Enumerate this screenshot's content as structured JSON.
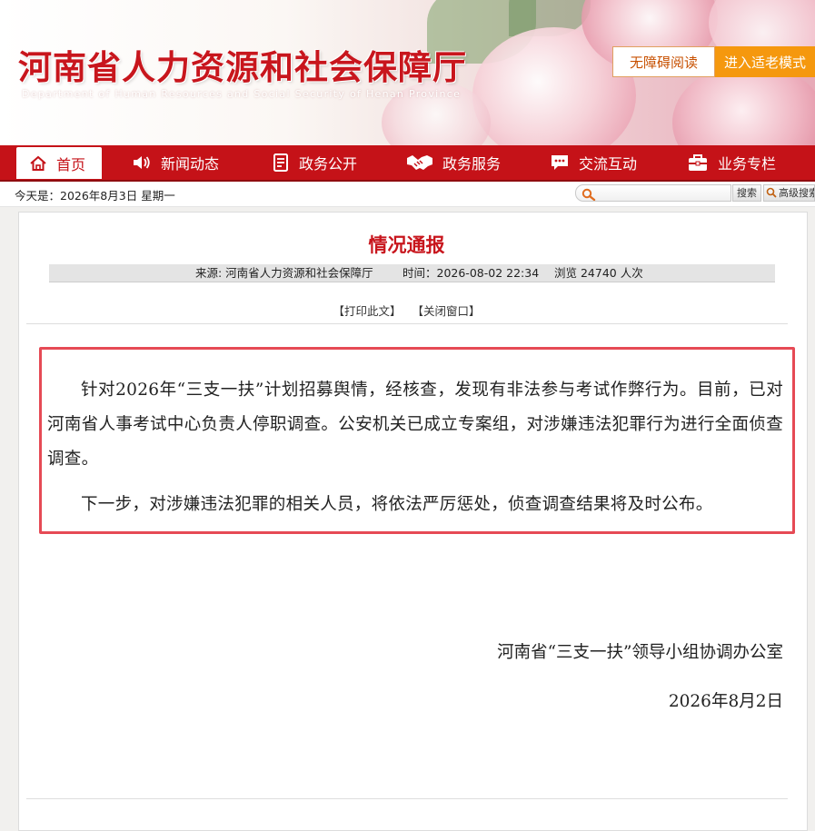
{
  "colors": {
    "brand_red": "#c8161d",
    "nav_red": "#c51218",
    "accent_orange": "#f5980e",
    "highlight_border": "#e64a55"
  },
  "header": {
    "title": "河南省人力资源和社会保障厅",
    "subtitle": "Department of Human Resources and Social Security of Henan Province",
    "a11y_label": "无障碍阅读",
    "elder_mode_label": "进入适老模式"
  },
  "nav": {
    "items": [
      {
        "label": "首页",
        "icon": "home-icon",
        "active": true
      },
      {
        "label": "新闻动态",
        "icon": "speaker-icon",
        "active": false
      },
      {
        "label": "政务公开",
        "icon": "document-icon",
        "active": false
      },
      {
        "label": "政务服务",
        "icon": "handshake-icon",
        "active": false
      },
      {
        "label": "交流互动",
        "icon": "chat-icon",
        "active": false
      },
      {
        "label": "业务专栏",
        "icon": "briefcase-icon",
        "active": false
      }
    ]
  },
  "toolbar": {
    "today_text": "今天是：2026年8月3日 星期一",
    "search_button_label": "搜索",
    "advanced_search_label": "高级搜索",
    "search_icon": "search-icon"
  },
  "article": {
    "title": "情况通报",
    "meta": {
      "source": "来源:  河南省人力资源和社会保障厅",
      "time": "时间：2026-08-02 22:34",
      "views": "浏览 24740 人次"
    },
    "print_label": "【打印此文】",
    "close_label": "【关闭窗口】",
    "paragraphs": [
      "针对2026年“三支一扶”计划招募舆情，经核查，发现有非法参与考试作弊行为。目前，已对河南省人事考试中心负责人停职调查。公安机关已成立专案组，对涉嫌违法犯罪行为进行全面侦查调查。",
      "下一步，对涉嫌违法犯罪的相关人员，将依法严厉惩处，侦查调查结果将及时公布。"
    ],
    "signature_org": "河南省“三支一扶”领导小组协调办公室",
    "signature_date": "2026年8月2日"
  }
}
